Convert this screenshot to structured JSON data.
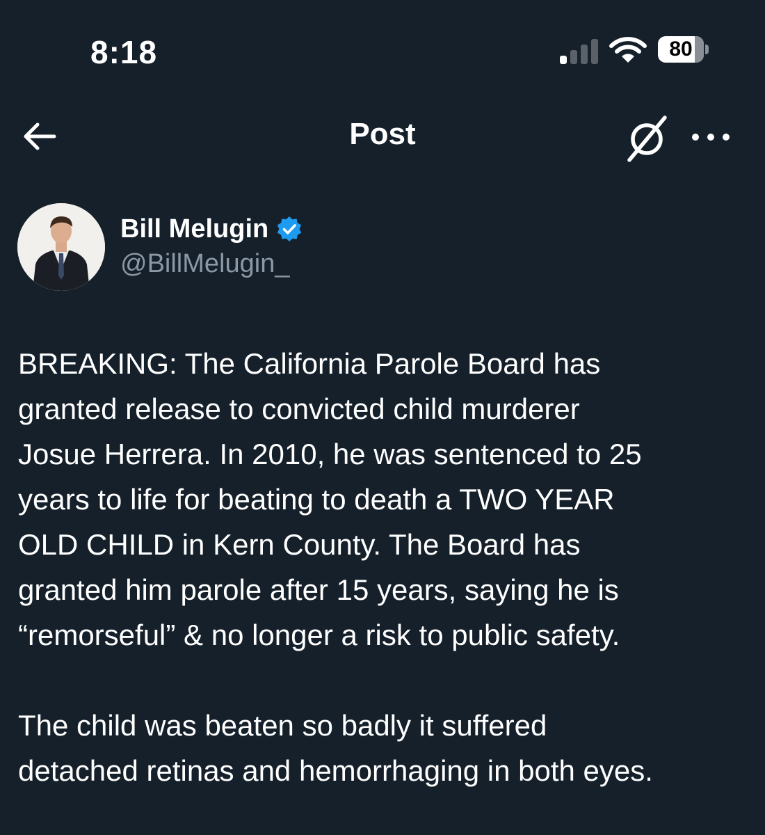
{
  "status_bar": {
    "time": "8:18",
    "battery_level": "80",
    "battery_fraction": 0.8,
    "signal_bars_active": 1,
    "signal_bars_total": 4,
    "icons": [
      "signal-icon",
      "wifi-icon",
      "battery-icon"
    ]
  },
  "nav": {
    "title": "Post",
    "icons": [
      "back-arrow-icon",
      "grok-icon",
      "more-icon"
    ]
  },
  "author": {
    "name": "Bill Melugin",
    "handle": "@BillMelugin_",
    "verified": true,
    "badge_color": "#1d9bf0"
  },
  "post": {
    "paragraph_1": "BREAKING: The California Parole Board has\ngranted release to convicted child murderer\nJosue Herrera. In 2010, he was sentenced to 25\nyears to life for beating to death a TWO YEAR\nOLD CHILD in Kern County. The Board has\ngranted him parole after 15 years, saying he is\n“remorseful” & no longer a risk to public safety.",
    "paragraph_2": "The child was beaten so badly it suffered\ndetached retinas and hemorrhaging in both eyes."
  },
  "colors": {
    "background": "#15202b",
    "text": "#ffffff",
    "secondary_text": "#8b98a5",
    "accent": "#1d9bf0"
  }
}
